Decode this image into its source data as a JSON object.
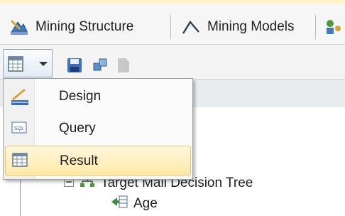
{
  "tabs": [
    {
      "label": "Mining Structure",
      "icon": "mining-structure-icon"
    },
    {
      "label": "Mining Models",
      "icon": "mining-models-icon"
    },
    {
      "label": "",
      "icon": "mining-model-viewer-icon"
    }
  ],
  "toolbar": {
    "view_button_icon": "result-grid-icon",
    "icons": [
      "save-icon",
      "run-query-icon",
      "disabled-document-icon"
    ]
  },
  "view_menu": {
    "items": [
      {
        "label": "Design",
        "icon": "design-icon",
        "selected": false
      },
      {
        "label": "Query",
        "icon": "sql-query-icon",
        "selected": false
      },
      {
        "label": "Result",
        "icon": "result-grid-icon",
        "selected": true
      }
    ]
  },
  "tree": {
    "root": {
      "label": "Target Mail Decision Tree",
      "icon": "decision-tree-icon"
    },
    "children": [
      {
        "label": "Age",
        "icon": "column-icon"
      }
    ]
  },
  "colors": {
    "menu_highlight": "#ffe9a6",
    "menu_highlight_border": "#e6c36a",
    "view_button_border": "#8aa2c4",
    "top_strip": "#fff4c9"
  }
}
